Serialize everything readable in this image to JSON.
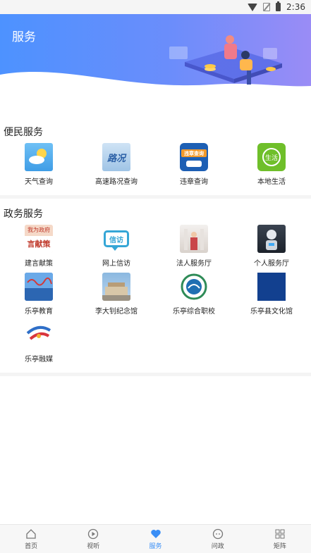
{
  "status_bar": {
    "time": "2:36"
  },
  "header": {
    "title": "服务"
  },
  "sections": {
    "convenience": {
      "title": "便民服务",
      "items": [
        {
          "label": "天气查询",
          "icon": "weather-icon"
        },
        {
          "label": "高速路况查询",
          "icon": "road-condition-icon"
        },
        {
          "label": "违章查询",
          "icon": "violation-query-icon"
        },
        {
          "label": "本地生活",
          "icon": "local-life-icon"
        }
      ]
    },
    "government": {
      "title": "政务服务",
      "items": [
        {
          "label": "建言献策",
          "icon": "suggestion-icon",
          "icon_text_top": "我为政府",
          "icon_text_bottom": "言献策"
        },
        {
          "label": "网上信访",
          "icon": "petition-icon",
          "icon_text": "信访"
        },
        {
          "label": "法人服务厅",
          "icon": "legal-person-hall-icon"
        },
        {
          "label": "个人服务厅",
          "icon": "personal-hall-icon"
        },
        {
          "label": "乐亭教育",
          "icon": "education-icon"
        },
        {
          "label": "李大钊纪念馆",
          "icon": "memorial-hall-icon"
        },
        {
          "label": "乐亭综合职校",
          "icon": "vocational-school-icon"
        },
        {
          "label": "乐亭县文化馆",
          "icon": "culture-center-icon"
        },
        {
          "label": "乐亭融媒",
          "icon": "media-center-icon"
        }
      ]
    }
  },
  "tiles": {
    "road_text": "路况",
    "violation_text": "违章查询",
    "life_text": "生活"
  },
  "bottom_nav": [
    {
      "label": "首页",
      "icon": "home-icon"
    },
    {
      "label": "视听",
      "icon": "play-icon"
    },
    {
      "label": "服务",
      "icon": "heart-icon",
      "active": true
    },
    {
      "label": "问政",
      "icon": "chat-icon"
    },
    {
      "label": "矩阵",
      "icon": "grid-icon"
    }
  ],
  "colors": {
    "accent": "#3a8ef6",
    "banner_start": "#4d92ff",
    "banner_end": "#9a8cf6"
  }
}
